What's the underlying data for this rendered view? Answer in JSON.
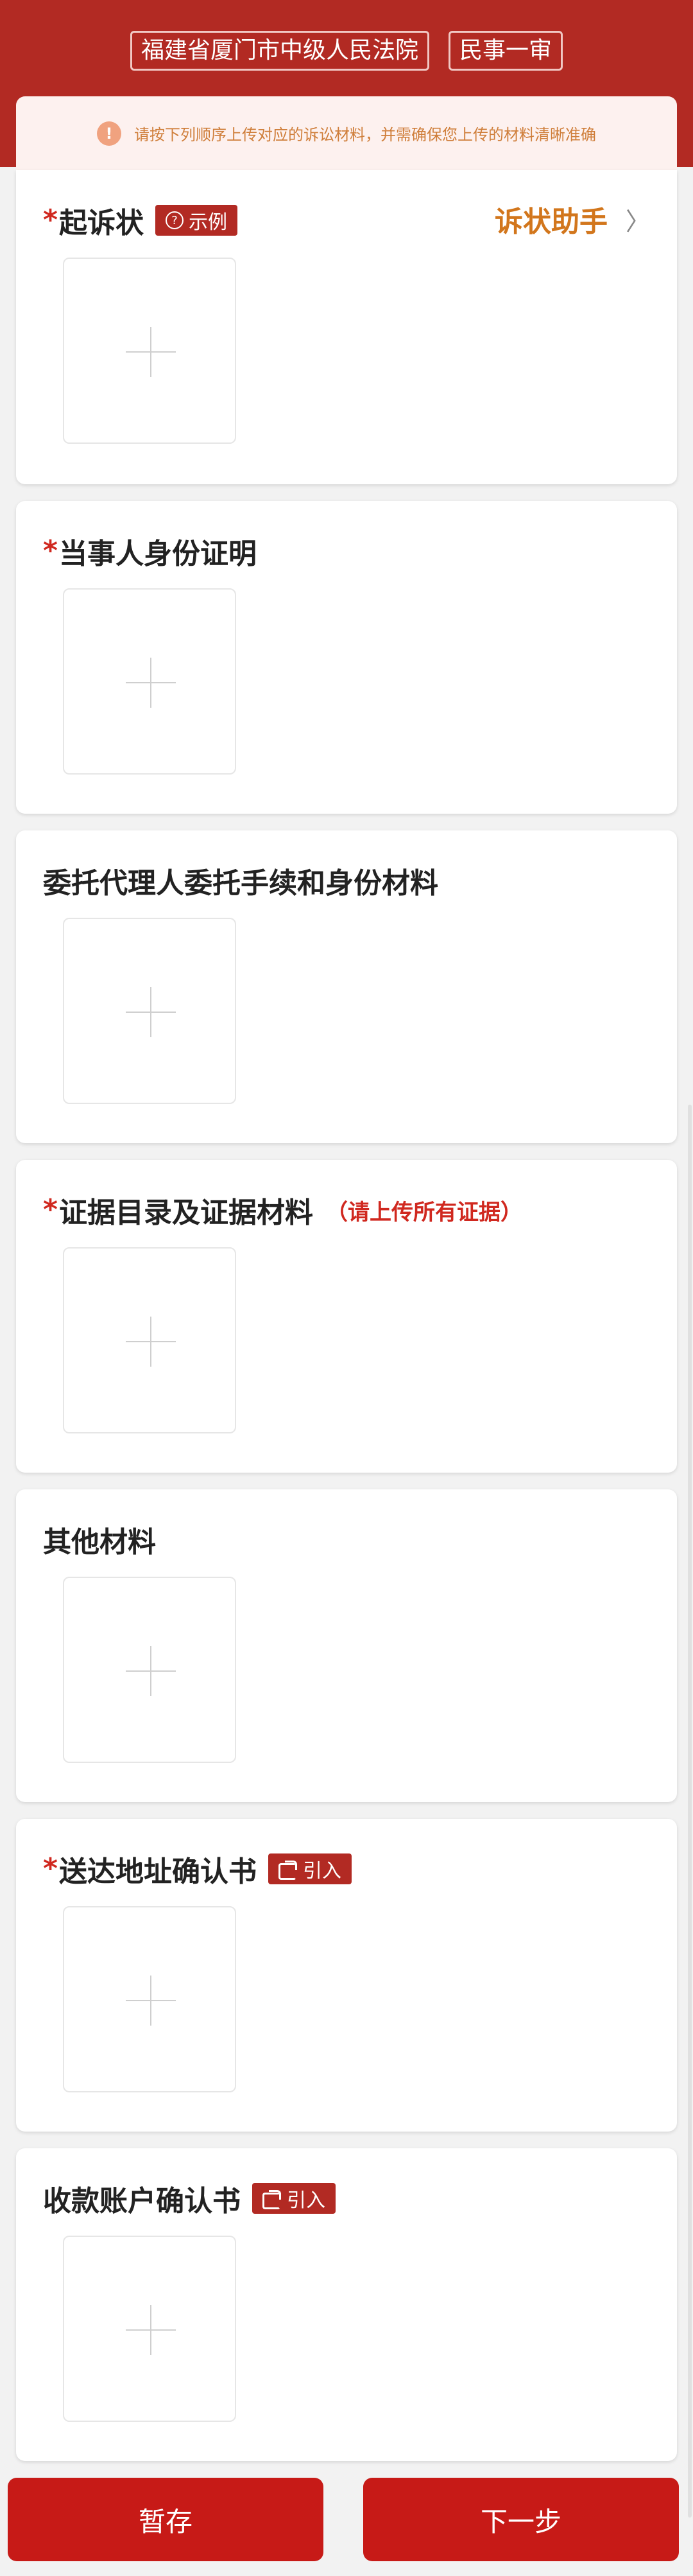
{
  "header": {
    "court": "福建省厦门市中级人民法院",
    "case_type": "民事一审"
  },
  "notice": {
    "icon": "!",
    "text": "请按下列顺序上传对应的诉讼材料，并需确保您上传的材料清晰准确"
  },
  "sections": [
    {
      "required": "*",
      "title": "起诉状",
      "badge": "示例",
      "badge_icon": "question-icon",
      "assistant": "诉状助手",
      "chevron": "〉"
    },
    {
      "required": "*",
      "title": "当事人身份证明"
    },
    {
      "title": "委托代理人委托手续和身份材料"
    },
    {
      "required": "*",
      "title": "证据目录及证据材料",
      "hint": "（请上传所有证据）"
    },
    {
      "title": "其他材料"
    },
    {
      "required": "*",
      "title": "送达地址确认书",
      "badge": "引入",
      "badge_icon": "import-icon"
    },
    {
      "title": "收款账户确认书",
      "badge": "引入",
      "badge_icon": "import-icon"
    }
  ],
  "footer": {
    "save_label": "暂存",
    "next_label": "下一步"
  },
  "colors": {
    "brand_red": "#b22a23",
    "button_red": "#c71a17",
    "assistant_orange": "#d2761c",
    "notice_text": "#cf7e3a",
    "required_red": "#d0281f"
  }
}
